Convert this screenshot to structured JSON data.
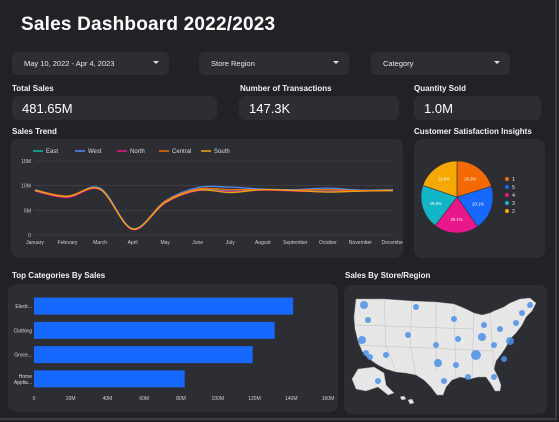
{
  "title": "Sales Dashboard 2022/2023",
  "filters": {
    "date_range": "May 10, 2022 - Apr 4, 2023",
    "store_region": "Store Region",
    "category": "Category"
  },
  "kpis": {
    "total_sales_label": "Total Sales",
    "total_sales_value": "481.65M",
    "transactions_label": "Number of Transactions",
    "transactions_value": "147.3K",
    "quantity_label": "Quantity Sold",
    "quantity_value": "1.0M"
  },
  "sections": {
    "sales_trend": "Sales Trend",
    "satisfaction": "Customer Satisfaction Insights",
    "top_categories": "Top Categories By Sales",
    "by_store": "Sales By Store/Region"
  },
  "colors": {
    "east": "#12b5a6",
    "west": "#4e8ff0",
    "north": "#e8178a",
    "central": "#f56a00",
    "south": "#e8a317",
    "bar": "#1668ff",
    "map_land": "#e7e7e7",
    "map_dot": "#4a8fe8"
  },
  "chart_data": [
    {
      "type": "line",
      "title": "Sales Trend",
      "categories": [
        "January",
        "February",
        "March",
        "April",
        "May",
        "June",
        "July",
        "August",
        "September",
        "October",
        "November",
        "December"
      ],
      "y_ticks": [
        "0",
        "5M",
        "10M",
        "15M"
      ],
      "ylim": [
        0,
        15
      ],
      "legend_position": "top",
      "series": [
        {
          "name": "East",
          "color": "#12b5a6",
          "values": [
            9.0,
            7.7,
            9.4,
            1.2,
            6.7,
            9.2,
            8.9,
            9.2,
            9.0,
            8.9,
            9.0,
            9.0
          ]
        },
        {
          "name": "West",
          "color": "#4e8ff0",
          "values": [
            9.2,
            7.8,
            9.5,
            1.3,
            6.9,
            9.6,
            9.7,
            9.3,
            9.2,
            9.5,
            9.1,
            9.2
          ]
        },
        {
          "name": "North",
          "color": "#e8178a",
          "values": [
            8.9,
            7.6,
            9.2,
            1.1,
            6.5,
            9.0,
            8.8,
            9.1,
            8.9,
            8.8,
            8.9,
            9.0
          ]
        },
        {
          "name": "Central",
          "color": "#f56a00",
          "values": [
            9.1,
            7.9,
            9.3,
            1.2,
            6.8,
            9.3,
            9.2,
            9.2,
            9.1,
            9.2,
            9.0,
            9.1
          ]
        },
        {
          "name": "South",
          "color": "#e8a317",
          "values": [
            9.0,
            7.8,
            9.3,
            1.2,
            6.6,
            9.1,
            8.6,
            9.2,
            9.0,
            8.7,
            8.9,
            9.0
          ]
        }
      ]
    },
    {
      "type": "pie",
      "title": "Customer Satisfaction Insights",
      "legend_position": "right",
      "slices": [
        {
          "label": "1",
          "value": 20.2,
          "text": "20.2%",
          "color": "#f56a00"
        },
        {
          "label": "5",
          "value": 20.1,
          "text": "20.1%",
          "color": "#1668ff"
        },
        {
          "label": "4",
          "value": 20.1,
          "text": "20.1%",
          "color": "#e8178a"
        },
        {
          "label": "3",
          "value": 19.8,
          "text": "19.8%",
          "color": "#12b5c6"
        },
        {
          "label": "2",
          "value": 19.8,
          "text": "19.8%",
          "color": "#f5a800"
        }
      ]
    },
    {
      "type": "bar",
      "orientation": "horizontal",
      "title": "Top Categories By Sales",
      "categories": [
        "Electr...",
        "Clothing",
        "Groce...",
        "Home Applia..."
      ],
      "values": [
        141,
        131,
        119,
        82
      ],
      "xlim": [
        0,
        160
      ],
      "x_ticks": [
        "0",
        "20M",
        "40M",
        "60M",
        "80M",
        "100M",
        "120M",
        "140M",
        "160M"
      ]
    }
  ]
}
